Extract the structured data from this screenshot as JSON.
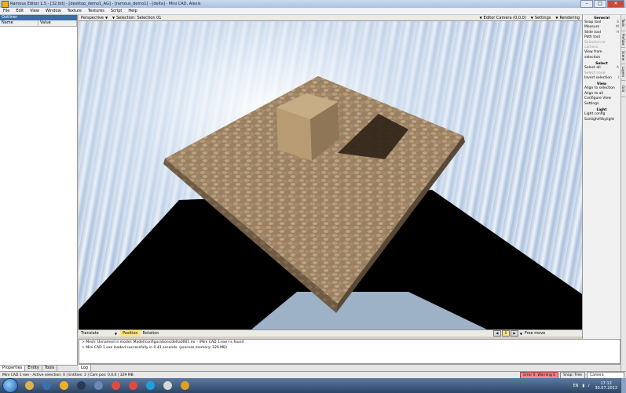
{
  "window": {
    "title": "Ramous Editor 1.5 - [32 bit] - [desktop_demo1_AG] - [ramous_demo1] - [delta] - Mini CAD, Alexis"
  },
  "menu": [
    "File",
    "Edit",
    "View",
    "Window",
    "Texture",
    "Textures",
    "Script",
    "Help"
  ],
  "left_panel": {
    "caption": "Outliner",
    "columns": [
      "Name",
      "Value"
    ],
    "tabs": [
      "Properties",
      "Entity",
      "Tools"
    ]
  },
  "viewport_toolbar": {
    "view_mode": "Perspective",
    "selection": "Selection: Selection 01",
    "camera": "Editor Camera (0,0,0)",
    "settings": "Settings",
    "rendering": "Rendering"
  },
  "viewport_bottom": {
    "mode": "Translate",
    "snap1": "Position",
    "snap2": "Rotation",
    "frame": "0",
    "move_label": "Free move"
  },
  "right_panel": {
    "sections": [
      {
        "title": "General",
        "rows": [
          {
            "label": "Snap tool",
            "value": "S",
            "disabled": false
          },
          {
            "label": "Measure",
            "value": "M",
            "disabled": false
          },
          {
            "label": "Slide tool",
            "value": "H",
            "disabled": false
          },
          {
            "label": "Path tool",
            "value": "",
            "disabled": false
          },
          {
            "label": "Selection to camera",
            "value": "",
            "disabled": true
          },
          {
            "label": "View from selection",
            "value": "",
            "disabled": false
          }
        ]
      },
      {
        "title": "Select",
        "rows": [
          {
            "label": "Select all",
            "value": "A",
            "disabled": false
          },
          {
            "label": "Select none",
            "value": "",
            "disabled": true
          },
          {
            "label": "Invert selection",
            "value": "I",
            "disabled": false
          }
        ]
      },
      {
        "title": "View",
        "rows": [
          {
            "label": "Align to selection",
            "value": "",
            "disabled": false
          },
          {
            "label": "Align to all",
            "value": "",
            "disabled": false
          },
          {
            "label": "Configure View Settings",
            "value": "",
            "disabled": false
          }
        ]
      },
      {
        "title": "Light",
        "rows": [
          {
            "label": "Light config",
            "value": "",
            "disabled": false
          },
          {
            "label": "Sunlight/Skylight",
            "value": "",
            "disabled": false
          }
        ]
      }
    ],
    "side_tabs": [
      "Tools",
      "Prefabs",
      "Scene",
      "Layers",
      "Grid"
    ]
  },
  "console": {
    "lines": [
      "> Mesh: Unnamed in model: Model/configurations/delta0001.mr - (Mini CAD 1.exe) is found",
      "> Mini CAD 1.exe loaded successfully in 0.43 seconds. (process memory: 329 MB)"
    ],
    "tab": "Log"
  },
  "statusbar": {
    "text": "Mini CAD 1 exe - Active selection: 0 | Entities: 2 | Cam pos: 0,0,0 | 329 MB",
    "box_red": "Error 0, Warning 0",
    "box_mid": "Snap: Free",
    "box_right": "Camera"
  },
  "taskbar": {
    "apps": [
      {
        "name": "explorer",
        "color": "#e0b34a"
      },
      {
        "name": "media",
        "color": "#3b6fb0"
      },
      {
        "name": "archlinux",
        "color": "#f0b020"
      },
      {
        "name": "steam",
        "color": "#2a3a55"
      },
      {
        "name": "vm",
        "color": "#6b88b8"
      },
      {
        "name": "chrome",
        "color": "#e04a3a"
      },
      {
        "name": "chrome2",
        "color": "#e04a3a"
      },
      {
        "name": "skype",
        "color": "#1ea0e0"
      },
      {
        "name": "foobar",
        "color": "#d8d8d8"
      },
      {
        "name": "gear",
        "color": "#e0a020"
      }
    ],
    "lang": "EN",
    "time": "17:12",
    "date": "30.07.2013"
  }
}
